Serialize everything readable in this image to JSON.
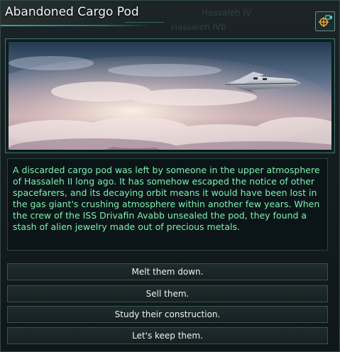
{
  "window": {
    "title": "Abandoned Cargo Pod",
    "background_labels": [
      "Hassaleh IV",
      "Hassaleh IVb"
    ]
  },
  "header": {
    "camera_button_icon": "camera-locate-icon"
  },
  "image": {
    "subject": "cargo-ship-over-clouds"
  },
  "description": "A discarded cargo pod was left by someone in the upper atmosphere of Hassaleh II long ago. It has somehow escaped the notice of other spacefarers, and its decaying orbit means it would have been lost in the gas giant's crushing atmosphere within another few years. When the crew of the ISS Drivafin Avabb unsealed the pod, they found a stash of alien jewelry made out of precious metals.",
  "options": [
    {
      "label": "Melt them down."
    },
    {
      "label": "Sell them."
    },
    {
      "label": "Study their construction."
    },
    {
      "label": "Let's keep them."
    }
  ],
  "colors": {
    "accent": "#3aa59a",
    "description_text": "#7cf2b0",
    "button_icon": "#f0a23a"
  }
}
